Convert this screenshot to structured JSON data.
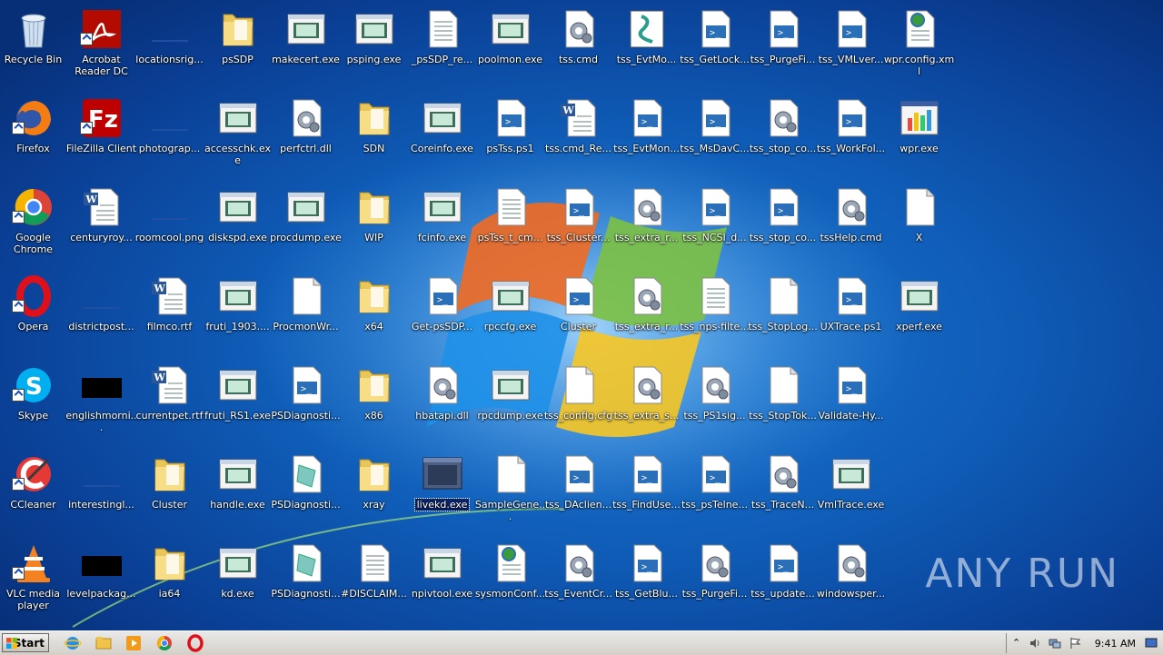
{
  "icons": [
    {
      "label": "Recycle Bin",
      "col": 0,
      "row": 0,
      "type": "recycle"
    },
    {
      "label": "Acrobat Reader DC",
      "col": 1,
      "row": 0,
      "type": "acrobat",
      "shortcut": true
    },
    {
      "label": "locationsrig...",
      "col": 2,
      "row": 0,
      "type": "blank-dark"
    },
    {
      "label": "psSDP",
      "col": 3,
      "row": 0,
      "type": "folder"
    },
    {
      "label": "makecert.exe",
      "col": 4,
      "row": 0,
      "type": "exe"
    },
    {
      "label": "psping.exe",
      "col": 5,
      "row": 0,
      "type": "exe"
    },
    {
      "label": "_psSDP_re...",
      "col": 6,
      "row": 0,
      "type": "doc"
    },
    {
      "label": "poolmon.exe",
      "col": 7,
      "row": 0,
      "type": "exe"
    },
    {
      "label": "tss.cmd",
      "col": 8,
      "row": 0,
      "type": "gear"
    },
    {
      "label": "tss_EvtMo...",
      "col": 9,
      "row": 0,
      "type": "script"
    },
    {
      "label": "tss_GetLock...",
      "col": 10,
      "row": 0,
      "type": "ps"
    },
    {
      "label": "tss_PurgeFi...",
      "col": 11,
      "row": 0,
      "type": "ps"
    },
    {
      "label": "tss_VMLver...",
      "col": 12,
      "row": 0,
      "type": "ps"
    },
    {
      "label": "wpr.config.xml",
      "col": 13,
      "row": 0,
      "type": "xml"
    },
    {
      "label": "Firefox",
      "col": 0,
      "row": 1,
      "type": "firefox",
      "shortcut": true
    },
    {
      "label": "FileZilla Client",
      "col": 1,
      "row": 1,
      "type": "filezilla",
      "shortcut": true
    },
    {
      "label": "photograp...",
      "col": 2,
      "row": 1,
      "type": "blank-dark"
    },
    {
      "label": "accesschk.exe",
      "col": 3,
      "row": 1,
      "type": "exe"
    },
    {
      "label": "perfctrl.dll",
      "col": 4,
      "row": 1,
      "type": "gear"
    },
    {
      "label": "SDN",
      "col": 5,
      "row": 1,
      "type": "folder"
    },
    {
      "label": "Coreinfo.exe",
      "col": 6,
      "row": 1,
      "type": "exe"
    },
    {
      "label": "psTss.ps1",
      "col": 7,
      "row": 1,
      "type": "ps"
    },
    {
      "label": "tss.cmd_Re...",
      "col": 8,
      "row": 1,
      "type": "word"
    },
    {
      "label": "tss_EvtMon...",
      "col": 9,
      "row": 1,
      "type": "ps"
    },
    {
      "label": "tss_MsDavC...",
      "col": 10,
      "row": 1,
      "type": "ps"
    },
    {
      "label": "tss_stop_co...",
      "col": 11,
      "row": 1,
      "type": "gear"
    },
    {
      "label": "tss_WorkFol...",
      "col": 12,
      "row": 1,
      "type": "ps"
    },
    {
      "label": "wpr.exe",
      "col": 13,
      "row": 1,
      "type": "chart"
    },
    {
      "label": "Google Chrome",
      "col": 0,
      "row": 2,
      "type": "chrome",
      "shortcut": true
    },
    {
      "label": "centuryroy...",
      "col": 1,
      "row": 2,
      "type": "word"
    },
    {
      "label": "roomcool.png",
      "col": 2,
      "row": 2,
      "type": "blank-dark"
    },
    {
      "label": "diskspd.exe",
      "col": 3,
      "row": 2,
      "type": "exe"
    },
    {
      "label": "procdump.exe",
      "col": 4,
      "row": 2,
      "type": "exe"
    },
    {
      "label": "WIP",
      "col": 5,
      "row": 2,
      "type": "folder"
    },
    {
      "label": "fcinfo.exe",
      "col": 6,
      "row": 2,
      "type": "exe"
    },
    {
      "label": "psTss_t_cm...",
      "col": 7,
      "row": 2,
      "type": "doc"
    },
    {
      "label": "tss_Cluster...",
      "col": 8,
      "row": 2,
      "type": "ps"
    },
    {
      "label": "tss_extra_r...",
      "col": 9,
      "row": 2,
      "type": "gear"
    },
    {
      "label": "tss_NCSI_d...",
      "col": 10,
      "row": 2,
      "type": "ps"
    },
    {
      "label": "tss_stop_co...",
      "col": 11,
      "row": 2,
      "type": "ps"
    },
    {
      "label": "tssHelp.cmd",
      "col": 12,
      "row": 2,
      "type": "gear"
    },
    {
      "label": "X",
      "col": 13,
      "row": 2,
      "type": "blank"
    },
    {
      "label": "Opera",
      "col": 0,
      "row": 3,
      "type": "opera",
      "shortcut": true
    },
    {
      "label": "districtpost...",
      "col": 1,
      "row": 3,
      "type": "blank-dark"
    },
    {
      "label": "filmco.rtf",
      "col": 2,
      "row": 3,
      "type": "word"
    },
    {
      "label": "fruti_1903....",
      "col": 3,
      "row": 3,
      "type": "exe"
    },
    {
      "label": "ProcmonWr...",
      "col": 4,
      "row": 3,
      "type": "blank"
    },
    {
      "label": "x64",
      "col": 5,
      "row": 3,
      "type": "folder"
    },
    {
      "label": "Get-psSDP...",
      "col": 6,
      "row": 3,
      "type": "ps"
    },
    {
      "label": "rpccfg.exe",
      "col": 7,
      "row": 3,
      "type": "exe"
    },
    {
      "label": "Cluster",
      "col": 8,
      "row": 3,
      "type": "ps"
    },
    {
      "label": "tss_extra_r...",
      "col": 9,
      "row": 3,
      "type": "gear"
    },
    {
      "label": "tss_nps-filte...",
      "col": 10,
      "row": 3,
      "type": "doc"
    },
    {
      "label": "tss_StopLog...",
      "col": 11,
      "row": 3,
      "type": "blank"
    },
    {
      "label": "UXTrace.ps1",
      "col": 12,
      "row": 3,
      "type": "ps"
    },
    {
      "label": "xperf.exe",
      "col": 13,
      "row": 3,
      "type": "exe"
    },
    {
      "label": "Skype",
      "col": 0,
      "row": 4,
      "type": "skype",
      "shortcut": true
    },
    {
      "label": "englishmorni...",
      "col": 1,
      "row": 4,
      "type": "black"
    },
    {
      "label": "currentpet.rtf",
      "col": 2,
      "row": 4,
      "type": "word"
    },
    {
      "label": "fruti_RS1.exe",
      "col": 3,
      "row": 4,
      "type": "exe"
    },
    {
      "label": "PSDiagnosti...",
      "col": 4,
      "row": 4,
      "type": "ps"
    },
    {
      "label": "x86",
      "col": 5,
      "row": 4,
      "type": "folder"
    },
    {
      "label": "hbatapi.dll",
      "col": 6,
      "row": 4,
      "type": "gear"
    },
    {
      "label": "rpcdump.exe",
      "col": 7,
      "row": 4,
      "type": "exe"
    },
    {
      "label": "tss_config.cfg",
      "col": 8,
      "row": 4,
      "type": "blank"
    },
    {
      "label": "tss_extra_s...",
      "col": 9,
      "row": 4,
      "type": "gear"
    },
    {
      "label": "tss_PS1sig...",
      "col": 10,
      "row": 4,
      "type": "gear"
    },
    {
      "label": "tss_StopTok...",
      "col": 11,
      "row": 4,
      "type": "blank"
    },
    {
      "label": "Validate-Hy...",
      "col": 12,
      "row": 4,
      "type": "ps"
    },
    {
      "label": "CCleaner",
      "col": 0,
      "row": 5,
      "type": "ccleaner",
      "shortcut": true
    },
    {
      "label": "interestingl...",
      "col": 1,
      "row": 5,
      "type": "blank-dark"
    },
    {
      "label": "Cluster",
      "col": 2,
      "row": 5,
      "type": "folder"
    },
    {
      "label": "handle.exe",
      "col": 3,
      "row": 5,
      "type": "exe"
    },
    {
      "label": "PSDiagnosti...",
      "col": 4,
      "row": 5,
      "type": "psdiag"
    },
    {
      "label": "xray",
      "col": 5,
      "row": 5,
      "type": "folder"
    },
    {
      "label": "livekd.exe",
      "col": 6,
      "row": 5,
      "type": "livekd",
      "selected": true
    },
    {
      "label": "SampleGene...",
      "col": 7,
      "row": 5,
      "type": "blank"
    },
    {
      "label": "tss_DAclien...",
      "col": 8,
      "row": 5,
      "type": "ps"
    },
    {
      "label": "tss_FindUse...",
      "col": 9,
      "row": 5,
      "type": "ps"
    },
    {
      "label": "tss_psTelne...",
      "col": 10,
      "row": 5,
      "type": "ps"
    },
    {
      "label": "tss_TraceN...",
      "col": 11,
      "row": 5,
      "type": "gear"
    },
    {
      "label": "VmlTrace.exe",
      "col": 12,
      "row": 5,
      "type": "exe"
    },
    {
      "label": "VLC media player",
      "col": 0,
      "row": 6,
      "type": "vlc",
      "shortcut": true
    },
    {
      "label": "levelpackag...",
      "col": 1,
      "row": 6,
      "type": "black"
    },
    {
      "label": "ia64",
      "col": 2,
      "row": 6,
      "type": "folder"
    },
    {
      "label": "kd.exe",
      "col": 3,
      "row": 6,
      "type": "exe"
    },
    {
      "label": "PSDiagnosti...",
      "col": 4,
      "row": 6,
      "type": "psdiag"
    },
    {
      "label": "#DISCLAIM...",
      "col": 5,
      "row": 6,
      "type": "doc"
    },
    {
      "label": "npivtool.exe",
      "col": 6,
      "row": 6,
      "type": "exe"
    },
    {
      "label": "sysmonConf...",
      "col": 7,
      "row": 6,
      "type": "xml"
    },
    {
      "label": "tss_EventCr...",
      "col": 8,
      "row": 6,
      "type": "gear"
    },
    {
      "label": "tss_GetBlu...",
      "col": 9,
      "row": 6,
      "type": "ps"
    },
    {
      "label": "tss_PurgeFi...",
      "col": 10,
      "row": 6,
      "type": "gear"
    },
    {
      "label": "tss_update...",
      "col": 11,
      "row": 6,
      "type": "ps"
    },
    {
      "label": "windowsper...",
      "col": 12,
      "row": 6,
      "type": "gear"
    }
  ],
  "watermark": "ANY RUN",
  "taskbar": {
    "start_label": "Start",
    "quick_launch": [
      "ie-icon",
      "explorer-icon",
      "media-player-icon",
      "chrome-icon",
      "opera-icon"
    ],
    "clock": "9:41 AM"
  },
  "colors": {
    "desktop": "#0f5db8",
    "taskbar": "#d4d0c8",
    "selection": "#0a246a"
  }
}
